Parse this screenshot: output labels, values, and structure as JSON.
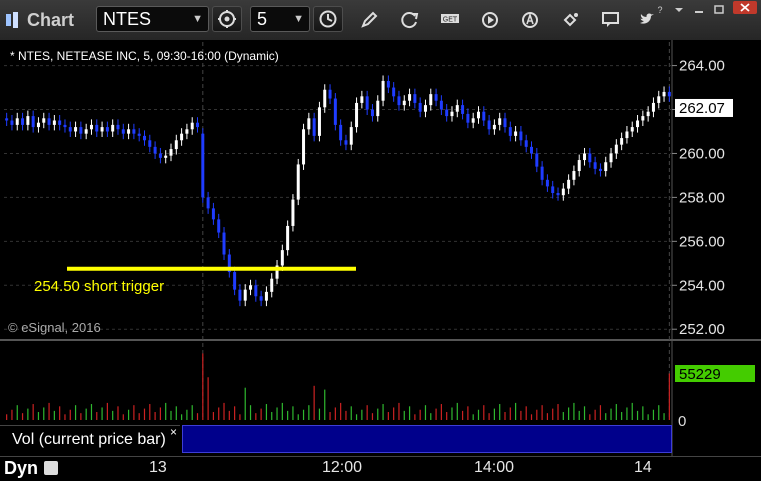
{
  "app": {
    "title": "Chart"
  },
  "toolbar": {
    "symbol": "NTES",
    "interval": "5"
  },
  "chart": {
    "header": "* NTES, NETEASE INC, 5, 09:30-16:00 (Dynamic)",
    "copyright": "© eSignal, 2016",
    "annotation": "254.50 short trigger",
    "last_price_label": "262.07",
    "volume_value_label": "55229",
    "volume_zero_label": "0",
    "volume_pane_label": "Vol (current price bar)",
    "volume_close": "×"
  },
  "status": {
    "mode": "Dyn"
  },
  "chart_data": {
    "type": "candlestick",
    "title": "* NTES, NETEASE INC, 5, 09:30-16:00 (Dynamic)",
    "y_ticks": [
      "264.00",
      "262.00",
      "260.00",
      "258.00",
      "256.00",
      "254.00",
      "252.00"
    ],
    "ylim": [
      251.6,
      264.8
    ],
    "x_tick_labels": [
      "13",
      "12:00",
      "14:00",
      "14"
    ],
    "bar_count": 126,
    "session_break_bars": [
      37,
      125
    ],
    "annotation": {
      "label": "254.50 short trigger",
      "y": 254.75,
      "color": "#ffff00"
    },
    "last_price": 262.07,
    "last_volume": 55229,
    "colors": {
      "up": "#ffffff",
      "down": "#1f3cff",
      "vol_up": "#2fb82f",
      "vol_down": "#cc2222",
      "last_price_box": "#ffffff",
      "volume_box": "#44cc00"
    },
    "prev_session_closes": [
      261.5,
      261.3,
      261.6,
      261.3,
      261.7,
      261.2,
      261.4,
      261.6,
      261.3,
      261.5,
      261.3,
      261.2,
      261.0,
      261.2,
      260.9,
      261.1,
      261.3,
      261.0,
      261.2,
      261.0,
      261.3,
      261.1,
      260.9,
      261.1,
      260.9,
      260.8,
      260.6,
      260.3,
      260.0,
      259.8,
      259.9,
      260.2,
      260.6,
      260.9,
      261.1,
      261.4,
      261.2
    ],
    "session_closes": [
      258.0,
      257.5,
      257.0,
      256.4,
      255.4,
      254.6,
      253.8,
      253.3,
      253.8,
      254.0,
      253.5,
      253.3,
      253.7,
      254.3,
      254.9,
      255.6,
      256.7,
      257.9,
      259.5,
      261.1,
      261.6,
      260.8,
      262.1,
      262.9,
      262.5,
      261.3,
      260.6,
      260.4,
      261.2,
      262.3,
      262.6,
      262.0,
      261.7,
      262.4,
      263.3,
      263.0,
      262.6,
      262.2,
      262.4,
      262.7,
      262.3,
      261.9,
      262.2,
      262.7,
      262.4,
      262.0,
      261.7,
      261.9,
      262.2,
      261.8,
      261.4,
      261.6,
      261.9,
      261.5,
      261.1,
      261.3,
      261.6,
      261.2,
      260.8,
      261.0,
      260.6,
      260.3,
      260.0,
      259.4,
      258.8,
      258.5,
      258.2,
      258.1,
      258.4,
      258.8,
      259.2,
      259.7,
      260.0,
      259.6,
      259.3,
      259.2,
      259.6,
      260.0,
      260.4,
      260.7,
      261.0,
      261.2,
      261.5,
      261.7,
      261.9,
      262.3,
      262.6,
      262.8,
      262.6,
      262.9,
      262.7,
      262.4,
      262.7,
      262.5,
      262.3,
      262.1,
      261.8,
      262.07
    ],
    "volume_ylim": [
      0,
      80000
    ],
    "volume_spikes": {
      "37": 70000,
      "38": 45000,
      "45": 34000,
      "58": 36000,
      "60": 32000,
      "125": 49000
    }
  }
}
